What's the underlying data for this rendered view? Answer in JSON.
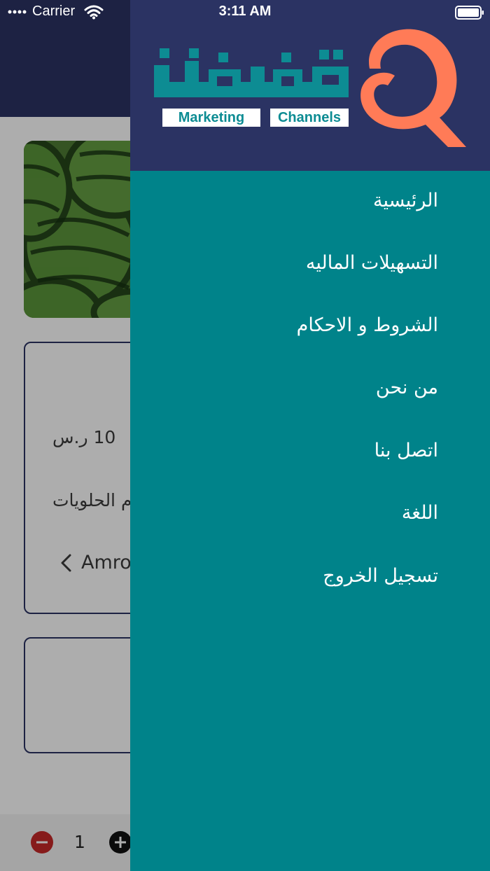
{
  "status_bar": {
    "carrier": "Carrier",
    "time": "3:11 AM"
  },
  "product": {
    "price": "10 ر.س",
    "category": "م الحلويات",
    "vendor": "Amro",
    "quantity": "1"
  },
  "drawer": {
    "logo": {
      "word_en_left": "Marketing",
      "word_en_right": "Channels",
      "colors": {
        "brand_teal": "#0d8c93",
        "brand_orange": "#ff7b57",
        "brand_navy": "#2b3363"
      }
    },
    "menu": [
      {
        "label": "الرئيسية"
      },
      {
        "label": "التسهيلات الماليه"
      },
      {
        "label": "الشروط و الاحكام"
      },
      {
        "label": "من نحن"
      },
      {
        "label": "اتصل بنا"
      },
      {
        "label": "اللغة"
      },
      {
        "label": "تسجيل الخروج"
      }
    ]
  }
}
